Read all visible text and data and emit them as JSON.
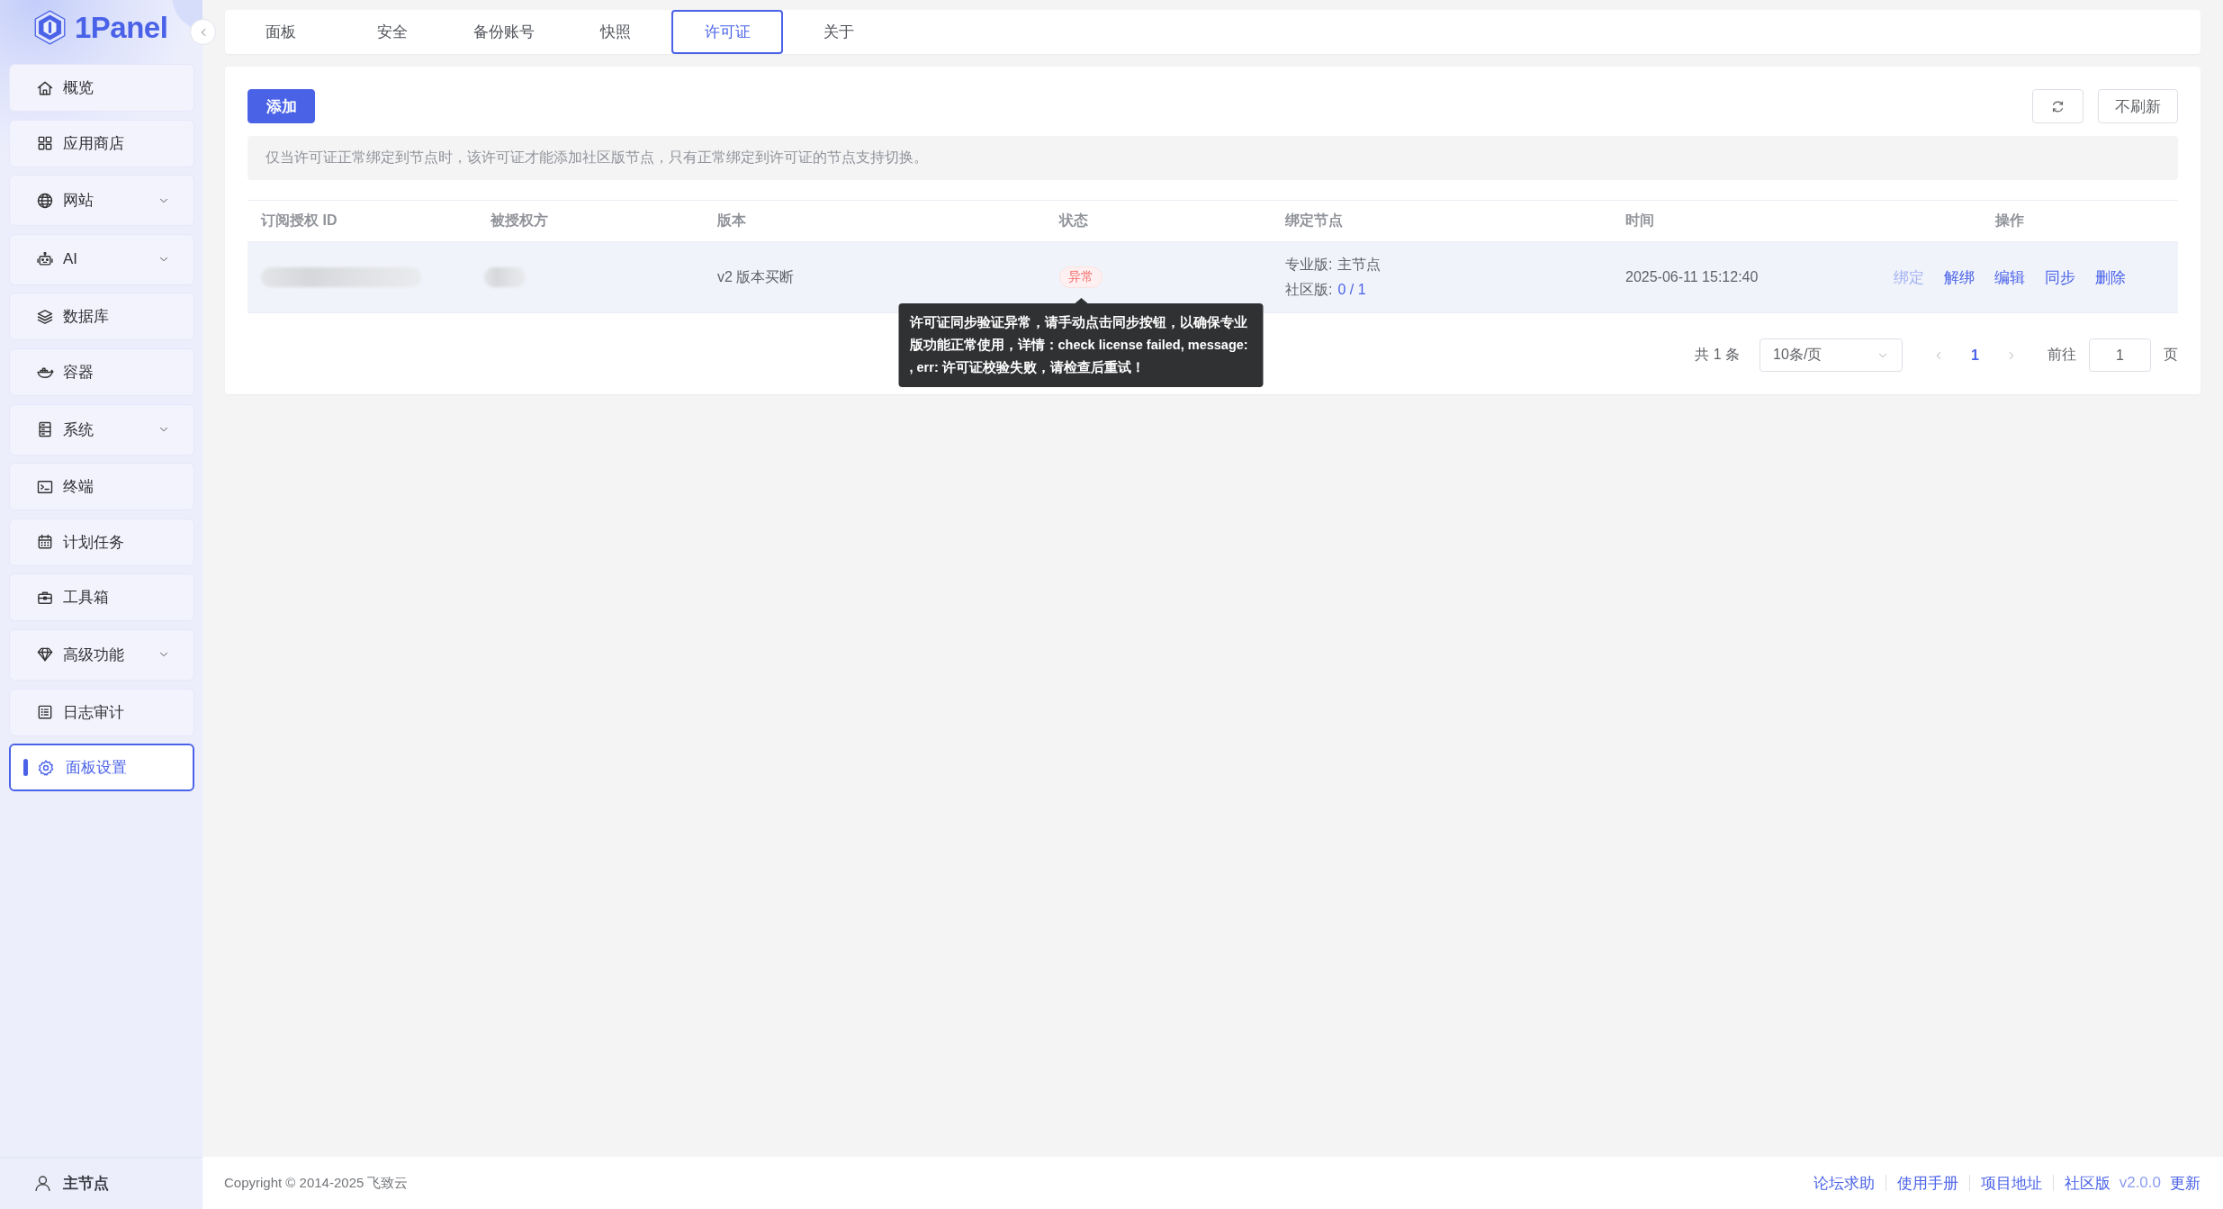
{
  "sidebar": {
    "logo": "1Panel",
    "items": [
      {
        "label": "概览",
        "has_submenu": false,
        "selected": false
      },
      {
        "label": "应用商店",
        "has_submenu": false,
        "selected": false
      },
      {
        "label": "网站",
        "has_submenu": true,
        "selected": false
      },
      {
        "label": "AI",
        "has_submenu": true,
        "selected": false
      },
      {
        "label": "数据库",
        "has_submenu": false,
        "selected": false
      },
      {
        "label": "容器",
        "has_submenu": false,
        "selected": false
      },
      {
        "label": "系统",
        "has_submenu": true,
        "selected": false
      },
      {
        "label": "终端",
        "has_submenu": false,
        "selected": false
      },
      {
        "label": "计划任务",
        "has_submenu": false,
        "selected": false
      },
      {
        "label": "工具箱",
        "has_submenu": false,
        "selected": false
      },
      {
        "label": "高级功能",
        "has_submenu": true,
        "selected": false
      },
      {
        "label": "日志审计",
        "has_submenu": false,
        "selected": false
      },
      {
        "label": "面板设置",
        "has_submenu": false,
        "selected": true
      }
    ],
    "node": "主节点"
  },
  "tabs": [
    {
      "label": "面板",
      "selected": false
    },
    {
      "label": "安全",
      "selected": false
    },
    {
      "label": "备份账号",
      "selected": false
    },
    {
      "label": "快照",
      "selected": false
    },
    {
      "label": "许可证",
      "selected": true
    },
    {
      "label": "关于",
      "selected": false
    }
  ],
  "toolbar": {
    "add_button": "添加",
    "auto_refresh_button": "不刷新"
  },
  "notice": "仅当许可证正常绑定到节点时，该许可证才能添加社区版节点，只有正常绑定到许可证的节点支持切换。",
  "table": {
    "columns": [
      "订阅授权 ID",
      "被授权方",
      "版本",
      "状态",
      "绑定节点",
      "时间",
      "操作"
    ],
    "rows": [
      {
        "hovered": true,
        "cells": [
          {
            "kind": "redacted"
          },
          {
            "kind": "redacted"
          },
          {
            "kind": "text",
            "text": "v2 版本买断"
          },
          {
            "kind": "status",
            "text": "异常",
            "error": true,
            "tooltip": "许可证同步验证异常，请手动点击同步按钮，以确保专业版功能正常使用，详情：check license failed, message: , err: 许可证校验失败，请检查后重试！"
          },
          {
            "kind": "nodes",
            "lines": [
              {
                "label": "专业版:",
                "value": "主节点",
                "link": false
              },
              {
                "label": "社区版:",
                "value": "0 / 1",
                "link": true
              }
            ]
          },
          {
            "kind": "text",
            "text": "2025-06-11 15:12:40"
          },
          {
            "kind": "actions",
            "actions": [
              {
                "label": "绑定",
                "disabled": true
              },
              {
                "label": "解绑",
                "disabled": false
              },
              {
                "label": "编辑",
                "disabled": false
              },
              {
                "label": "同步",
                "disabled": false
              },
              {
                "label": "删除",
                "disabled": false
              }
            ]
          }
        ]
      }
    ]
  },
  "pagination": {
    "total": "共 1 条",
    "page_size": "10条/页",
    "pages": [
      {
        "label": "1",
        "selected": true
      }
    ],
    "goto_label": "前往",
    "goto_value": "1",
    "page_unit": "页"
  },
  "footer": {
    "copyright": "Copyright © 2014-2025 飞致云",
    "links": [
      "论坛求助",
      "使用手册",
      "项目地址"
    ],
    "edition": "社区版",
    "version": "v2.0.0",
    "update_link": "更新"
  }
}
